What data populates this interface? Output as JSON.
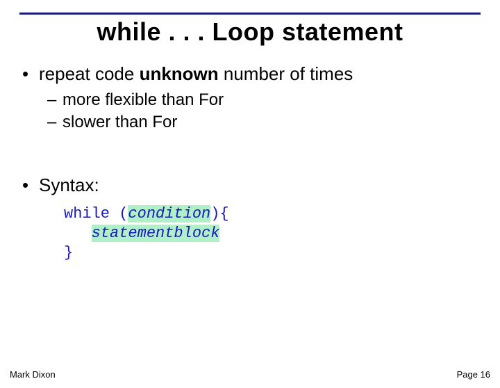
{
  "title": "while . . . Loop statement",
  "bullets": [
    {
      "text_pre": "repeat code ",
      "text_bold": "unknown",
      "text_post": " number of times",
      "subs": [
        "more flexible than For",
        "slower than For"
      ]
    },
    {
      "text_pre": "Syntax:",
      "text_bold": "",
      "text_post": "",
      "subs": []
    }
  ],
  "code": {
    "l1a": "while (",
    "l1b": "condition",
    "l1c": "){",
    "l2_indent": "   ",
    "l2": "statementblock",
    "l3": "}"
  },
  "footer": {
    "left": "Mark Dixon",
    "right": "Page 16"
  }
}
